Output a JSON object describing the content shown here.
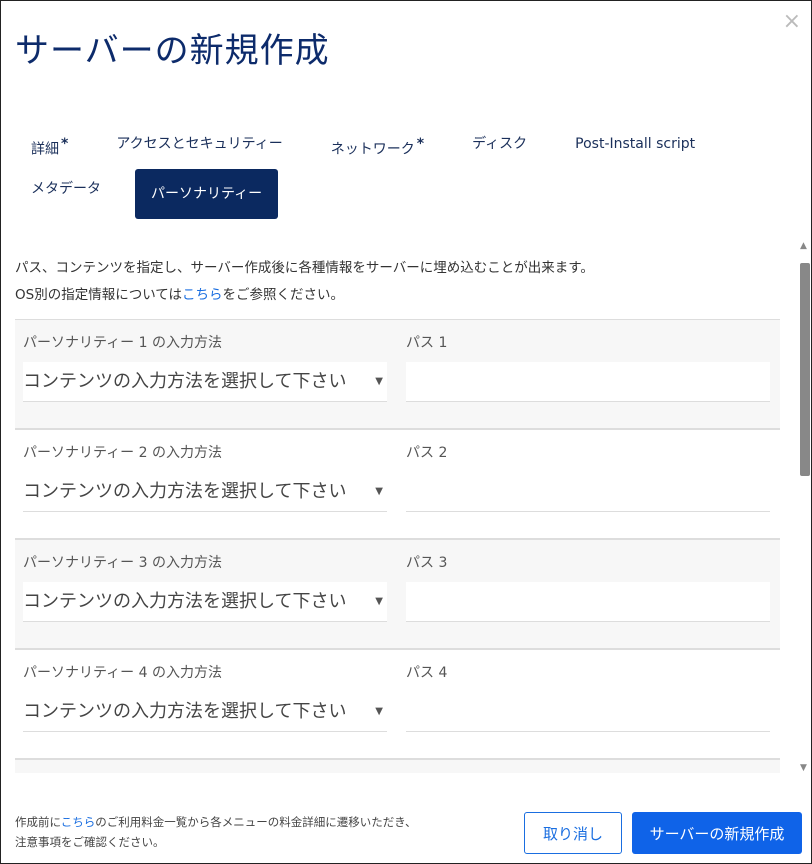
{
  "title": "サーバーの新規作成",
  "tabs": [
    {
      "label": "詳細",
      "required": "*"
    },
    {
      "label": "アクセスとセキュリティー"
    },
    {
      "label": "ネットワーク",
      "required": "*"
    },
    {
      "label": "ディスク"
    },
    {
      "label": "Post-Install script"
    },
    {
      "label": "メタデータ"
    },
    {
      "label": "パーソナリティー",
      "active": true
    }
  ],
  "description": {
    "line1": "パス、コンテンツを指定し、サーバー作成後に各種情報をサーバーに埋め込むことが出来ます。",
    "line2_prefix": "OS別の指定情報については",
    "line2_link": "こちら",
    "line2_suffix": "をご参照ください。"
  },
  "rows": [
    {
      "method_label": "パーソナリティー 1 の入力方法",
      "path_label": "パス 1",
      "select_value": "コンテンツの入力方法を選択して下さい",
      "path_value": ""
    },
    {
      "method_label": "パーソナリティー 2 の入力方法",
      "path_label": "パス 2",
      "select_value": "コンテンツの入力方法を選択して下さい",
      "path_value": ""
    },
    {
      "method_label": "パーソナリティー 3 の入力方法",
      "path_label": "パス 3",
      "select_value": "コンテンツの入力方法を選択して下さい",
      "path_value": ""
    },
    {
      "method_label": "パーソナリティー 4 の入力方法",
      "path_label": "パス 4",
      "select_value": "コンテンツの入力方法を選択して下さい",
      "path_value": ""
    }
  ],
  "footer": {
    "note_prefix": "作成前に",
    "note_link": "こちら",
    "note_suffix": "のご利用料金一覧から各メニューの料金詳細に遷移いただき、",
    "note_line2": "注意事項をご確認ください。",
    "cancel_label": "取り消し",
    "create_label": "サーバーの新規作成"
  },
  "icons": {
    "close": "×",
    "dropdown": "▼",
    "scroll_up": "▲",
    "scroll_down": "▼"
  }
}
